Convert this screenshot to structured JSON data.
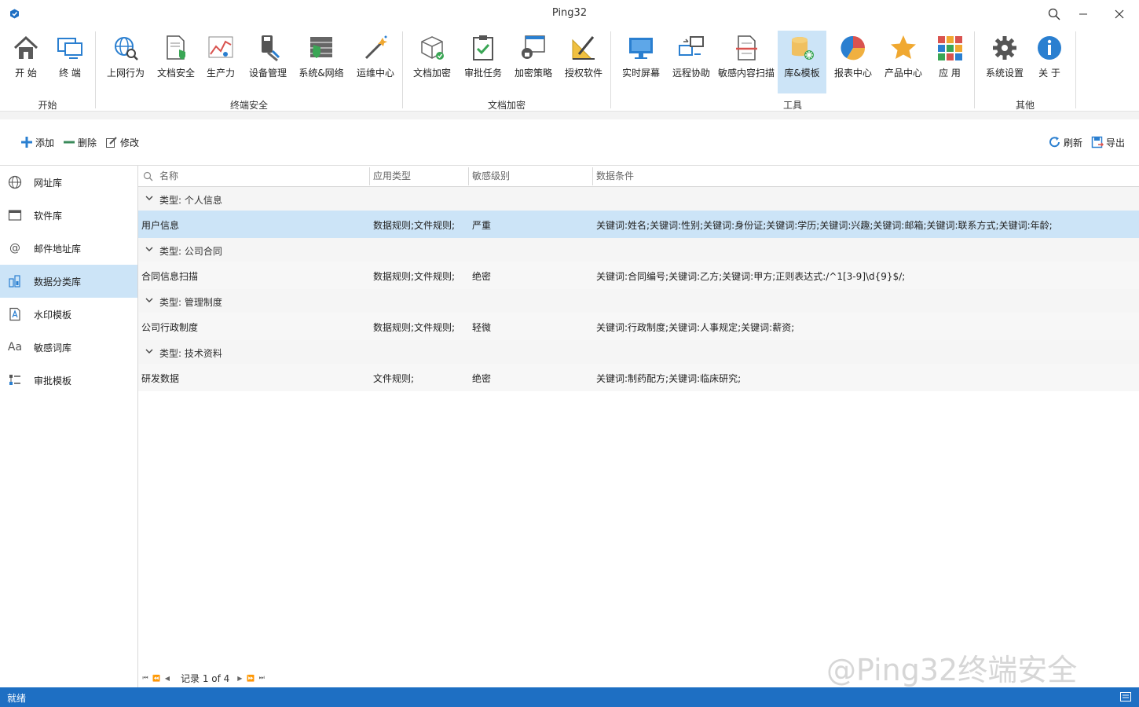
{
  "app": {
    "title": "Ping32"
  },
  "ribbon": {
    "buttons": [
      {
        "label": "开  始",
        "icon": "home-icon"
      },
      {
        "label": "终  端",
        "icon": "terminal-icon"
      },
      {
        "label": "上网行为",
        "icon": "web-behavior-icon"
      },
      {
        "label": "文档安全",
        "icon": "document-security-icon"
      },
      {
        "label": "生产力",
        "icon": "productivity-icon"
      },
      {
        "label": "设备管理",
        "icon": "device-management-icon"
      },
      {
        "label": "系统&网络",
        "icon": "system-network-icon"
      },
      {
        "label": "运维中心",
        "icon": "ops-center-icon"
      },
      {
        "label": "文档加密",
        "icon": "document-encryption-icon"
      },
      {
        "label": "审批任务",
        "icon": "approval-task-icon"
      },
      {
        "label": "加密策略",
        "icon": "encryption-policy-icon"
      },
      {
        "label": "授权软件",
        "icon": "authorized-software-icon"
      },
      {
        "label": "实时屏幕",
        "icon": "realtime-screen-icon"
      },
      {
        "label": "远程协助",
        "icon": "remote-assist-icon"
      },
      {
        "label": "敏感内容扫描",
        "icon": "sensitive-scan-icon"
      },
      {
        "label": "库&模板",
        "icon": "library-template-icon"
      },
      {
        "label": "报表中心",
        "icon": "report-center-icon"
      },
      {
        "label": "产品中心",
        "icon": "product-center-icon"
      },
      {
        "label": "应  用",
        "icon": "apps-icon"
      },
      {
        "label": "系统设置",
        "icon": "settings-icon"
      },
      {
        "label": "关  于",
        "icon": "info-icon"
      }
    ],
    "groups": [
      "开始",
      "终端安全",
      "文档加密",
      "工具",
      "其他"
    ]
  },
  "toolbar": {
    "add": "添加",
    "delete": "删除",
    "edit": "修改",
    "refresh": "刷新",
    "export": "导出"
  },
  "sidebar": {
    "items": [
      {
        "label": "网址库",
        "icon": "globe-icon"
      },
      {
        "label": "软件库",
        "icon": "window-icon"
      },
      {
        "label": "邮件地址库",
        "icon": "at-icon"
      },
      {
        "label": "数据分类库",
        "icon": "data-classify-icon"
      },
      {
        "label": "水印模板",
        "icon": "watermark-icon"
      },
      {
        "label": "敏感词库",
        "icon": "font-icon"
      },
      {
        "label": "审批模板",
        "icon": "approval-template-icon"
      }
    ]
  },
  "grid": {
    "columns": [
      "名称",
      "应用类型",
      "敏感级别",
      "数据条件"
    ],
    "groups": [
      {
        "label": "类型: 个人信息",
        "rows": [
          {
            "name": "用户信息",
            "type": "数据规则;文件规则;",
            "level": "严重",
            "condition": "关键词:姓名;关键词:性别;关键词:身份证;关键词:学历;关键词:兴趣;关键词:邮箱;关键词:联系方式;关键词:年龄;"
          }
        ]
      },
      {
        "label": "类型: 公司合同",
        "rows": [
          {
            "name": "合同信息扫描",
            "type": "数据规则;文件规则;",
            "level": "绝密",
            "condition": "关键词:合同编号;关键词:乙方;关键词:甲方;正则表达式:/^1[3-9]\\d{9}$/;"
          }
        ]
      },
      {
        "label": "类型: 管理制度",
        "rows": [
          {
            "name": "公司行政制度",
            "type": "数据规则;文件规则;",
            "level": "轻微",
            "condition": "关键词:行政制度;关键词:人事规定;关键词:薪资;"
          }
        ]
      },
      {
        "label": "类型: 技术资料",
        "rows": [
          {
            "name": "研发数据",
            "type": "文件规则;",
            "level": "绝密",
            "condition": "关键词:制药配方;关键词:临床研究;"
          }
        ]
      }
    ],
    "pager": "记录 1 of 4"
  },
  "status": {
    "text": "就绪"
  },
  "watermark": "@Ping32终端安全",
  "colors": {
    "accent": "#1e6fc3",
    "selection": "#cce4f7"
  }
}
